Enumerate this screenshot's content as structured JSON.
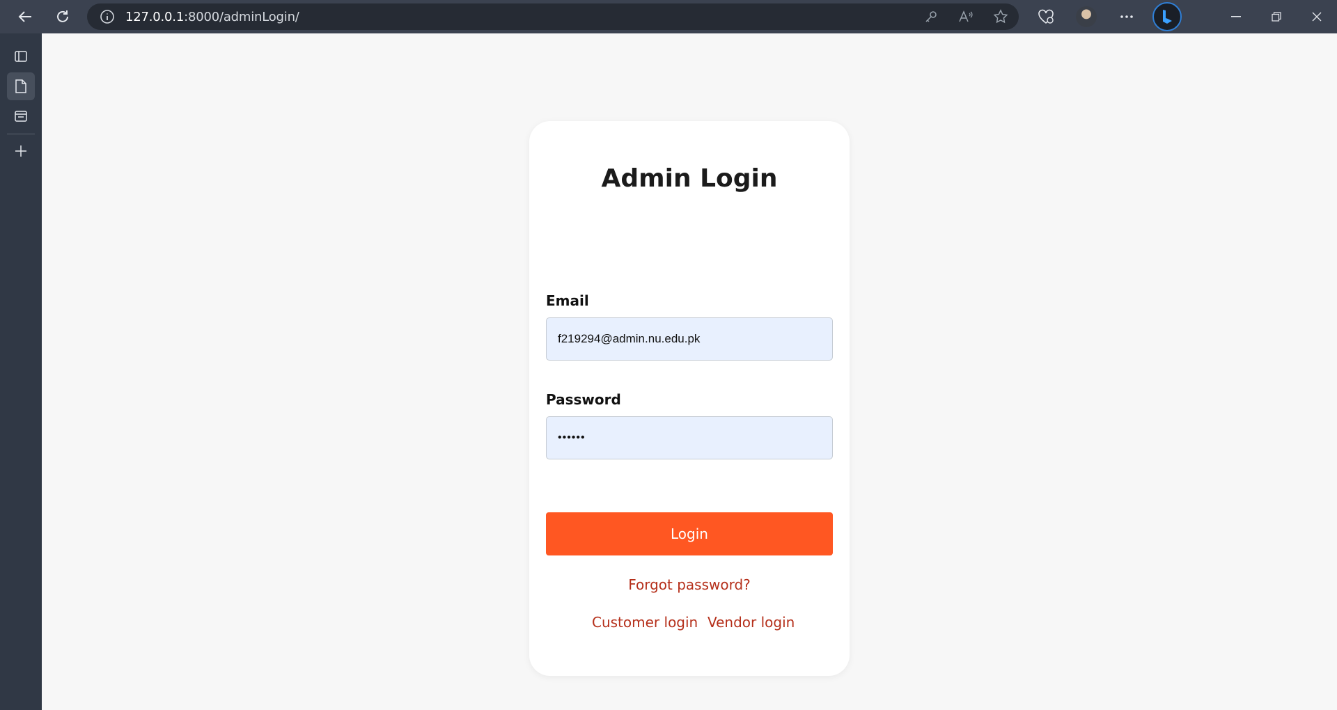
{
  "browser": {
    "url_host": "127.0.0.1",
    "url_path": ":8000/adminLogin/"
  },
  "login": {
    "title": "Admin Login",
    "email_label": "Email",
    "email_value": "f219294@admin.nu.edu.pk",
    "password_label": "Password",
    "password_value": "••••••",
    "login_button": "Login",
    "forgot_link": "Forgot password?",
    "customer_link": "Customer login",
    "vendor_link": "Vendor login"
  },
  "colors": {
    "accent": "#ff5722",
    "link": "#b52f1a",
    "input_bg": "#e8f0fe"
  }
}
